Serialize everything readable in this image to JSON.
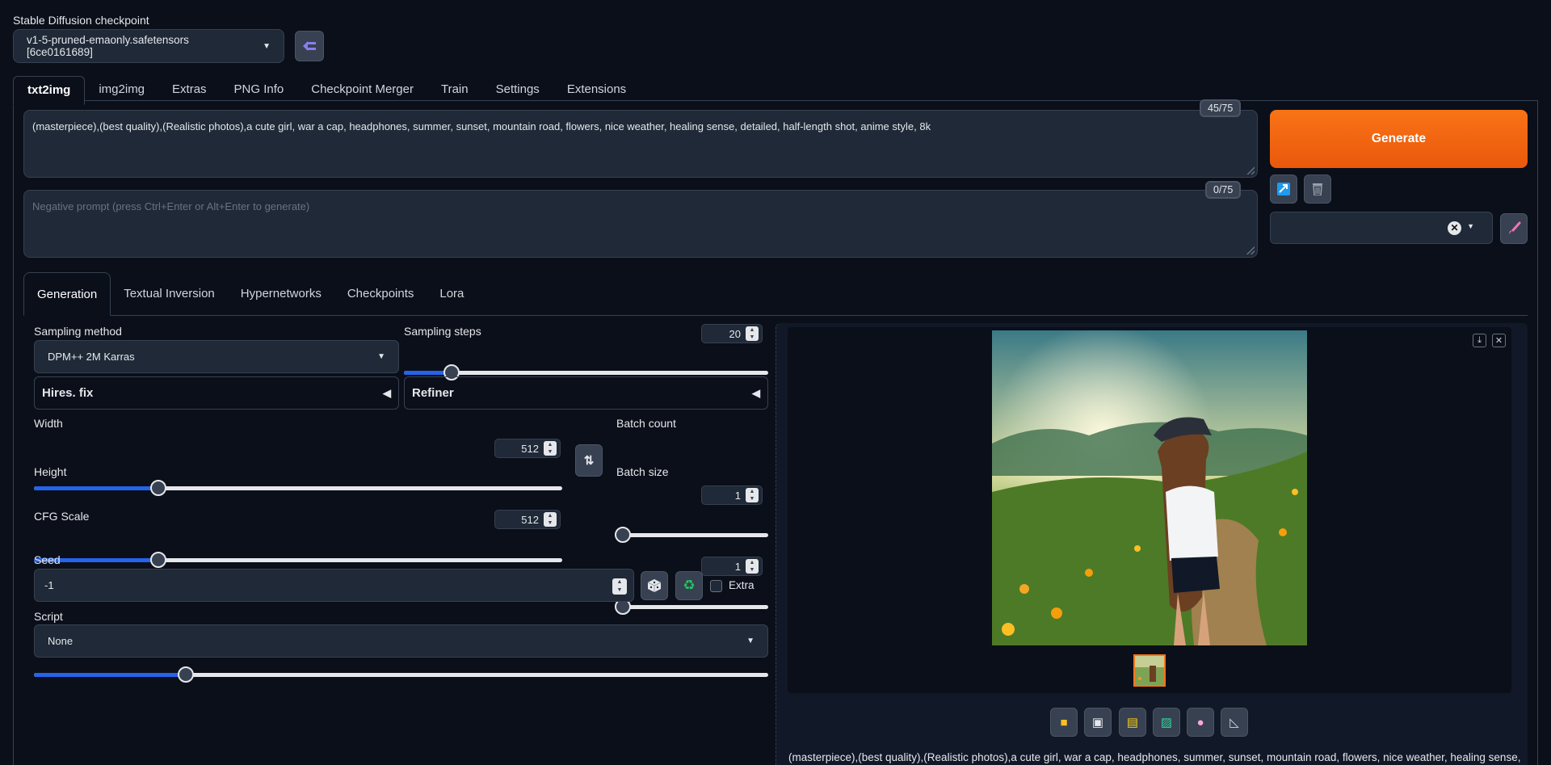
{
  "checkpoint": {
    "label": "Stable Diffusion checkpoint",
    "value": "v1-5-pruned-emaonly.safetensors [6ce0161689]"
  },
  "main_tabs": [
    "txt2img",
    "img2img",
    "Extras",
    "PNG Info",
    "Checkpoint Merger",
    "Train",
    "Settings",
    "Extensions"
  ],
  "prompt": {
    "positive": "(masterpiece),(best quality),(Realistic photos),a cute girl, war a cap, headphones, summer, sunset, mountain road, flowers, nice weather, healing sense, detailed, half-length shot, anime style, 8k",
    "positive_count": "45/75",
    "negative_placeholder": "Negative prompt (press Ctrl+Enter or Alt+Enter to generate)",
    "negative_count": "0/75"
  },
  "generate_label": "Generate",
  "sub_tabs": [
    "Generation",
    "Textual Inversion",
    "Hypernetworks",
    "Checkpoints",
    "Lora"
  ],
  "generation": {
    "sampling_method_label": "Sampling method",
    "sampling_method_value": "DPM++ 2M Karras",
    "sampling_steps_label": "Sampling steps",
    "sampling_steps_value": "20",
    "sampling_steps_fraction": 0.13,
    "hires_label": "Hires. fix",
    "refiner_label": "Refiner",
    "width_label": "Width",
    "width_value": "512",
    "width_fraction": 0.2353,
    "height_label": "Height",
    "height_value": "512",
    "height_fraction": 0.2353,
    "batch_count_label": "Batch count",
    "batch_count_value": "1",
    "batch_size_label": "Batch size",
    "batch_size_value": "1",
    "cfg_label": "CFG Scale",
    "cfg_value": "7",
    "cfg_fraction": 0.2069,
    "seed_label": "Seed",
    "seed_value": "-1",
    "extra_label": "Extra",
    "script_label": "Script",
    "script_value": "None"
  },
  "output": {
    "caption": "(masterpiece),(best quality),(Realistic photos),a cute girl, war a cap, headphones, summer, sunset, mountain road, flowers, nice weather, healing sense,"
  },
  "colors": {
    "accent": "#f97316",
    "slider_fill": "#2563eb",
    "background": "#0b0f19",
    "panel": "#1f2937"
  },
  "icons": {
    "refresh": "refresh-icon",
    "swap": "swap-icon",
    "dice": "dice-icon",
    "recycle": "recycle-icon",
    "folder": "folder-icon",
    "save": "save-icon",
    "zip": "zip-icon",
    "img2img": "image-icon",
    "inpaint": "palette-icon",
    "extras": "triangle-ruler-icon"
  }
}
